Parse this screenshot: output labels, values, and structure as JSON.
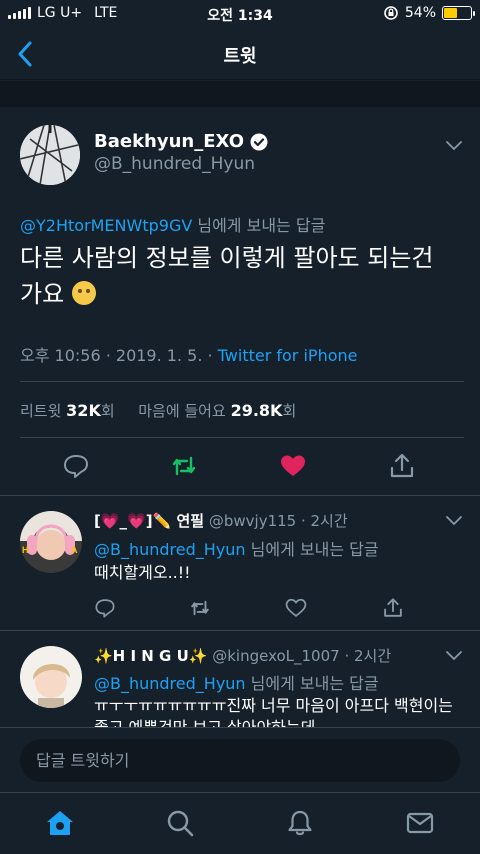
{
  "status": {
    "carrier": "LG U+",
    "network": "LTE",
    "time": "오전 1:34",
    "battery": "54%",
    "battery_level": 0.54
  },
  "nav": {
    "title": "트윗"
  },
  "tweet": {
    "author": "Baekhyun_EXO",
    "handle": "@B_hundred_Hyun",
    "reply_mention": "@Y2HtorMENWtp9GV",
    "reply_suffix": " 님에게 보내는 답글",
    "text": "다른 사람의 정보를 이렇게 팔아도 되는건 가요",
    "time": "오후 10:56 · 2019. 1. 5. · ",
    "client": "Twitter for iPhone",
    "retweets_label": "리트윗 ",
    "retweets_count": "32K",
    "retweets_unit": "회",
    "likes_label": "마음에 들어요 ",
    "likes_count": "29.8K",
    "likes_unit": "회"
  },
  "replies": [
    {
      "name": "[💗_💗]✏️ 연필",
      "handle": "@bwvjy115 · 2시간",
      "to_mention": "@B_hundred_Hyun",
      "to_suffix": " 님에게 보내는 답글",
      "text": "때치할게오..!!"
    },
    {
      "name": "✨H I N G U✨",
      "handle": "@kingexoL_1007 · 2시간",
      "to_mention": "@B_hundred_Hyun",
      "to_suffix": " 님에게 보내는 답글",
      "text": "ㅠㅜㅜㅠㅠㅠㅠㅠㅠ진짜 너무 마음이 아프다 백현이는 좋고 예쁜것만 보고 살아야하는데"
    }
  ],
  "compose": {
    "placeholder": "답글 트윗하기"
  },
  "colors": {
    "accent": "#1da1f2",
    "like": "#e0245e",
    "retweet": "#17bf63",
    "background": "#15202b"
  }
}
